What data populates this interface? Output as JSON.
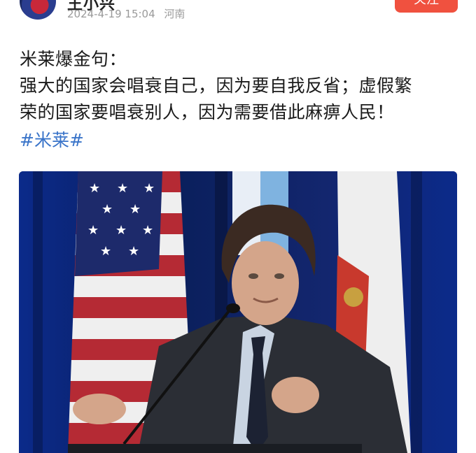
{
  "author": {
    "name": "王小兴",
    "date": "2024-4-19 15:04",
    "location": "河南"
  },
  "follow_button": {
    "label": "关注"
  },
  "post": {
    "lines": [
      "米莱爆金句：",
      "强大的国家会唱衰自己，因为要自我反省；虚假繁",
      "荣的国家要唱衰别人，因为需要借此麻痹人民！"
    ],
    "hashtag": "#米莱#"
  },
  "photo": {
    "subject": "photo-speaker-at-podium-with-flags"
  },
  "colors": {
    "accent": "#f0513f",
    "link": "#3a74c9",
    "meta": "#9a9a9a"
  }
}
